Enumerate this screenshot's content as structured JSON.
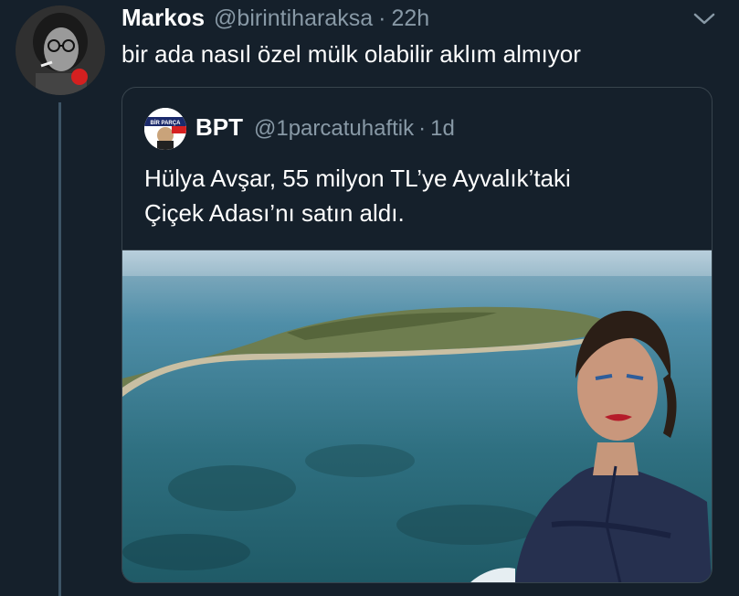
{
  "tweet": {
    "display_name": "Markos",
    "handle": "@birintiharaksa",
    "separator": "·",
    "time": "22h",
    "text": "bir ada nasıl özel mülk olabilir aklım almıyor",
    "menu_icon": "chevron-down-icon"
  },
  "quoted_tweet": {
    "display_name": "BPT",
    "handle": "@1parcatuhaftik",
    "separator": "·",
    "time": "1d",
    "text_line1": "Hülya Avşar, 55 milyon TL’ye Ayvalık’taki",
    "text_line2": "Çiçek Adası’nı satın aldı.",
    "avatar_logo_text": "BİR PARÇA TUHAF"
  },
  "colors": {
    "background": "#15202b",
    "primary_text": "#ffffff",
    "secondary_text": "#8899a6",
    "border": "#38444d",
    "thread_line": "#3d5466"
  }
}
